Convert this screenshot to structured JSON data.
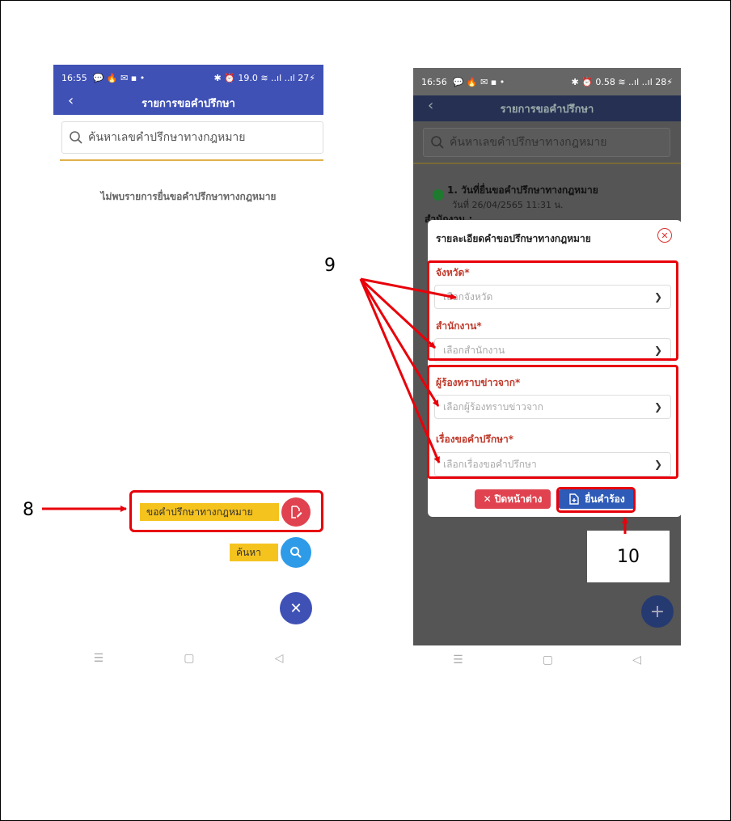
{
  "phone1": {
    "status_time": "16:55",
    "status_icons_left": "💬 🔥 ✉ ▪ •",
    "status_icons_right": "✱ ⏰ 19.0 ≋ ..ıl ..ıl 27⚡",
    "title": "รายการขอคำปรึกษา",
    "search_placeholder": "ค้นหาเลขคำปรึกษาทางกฎหมาย",
    "empty_message": "ไม่พบรายการยื่นขอคำปรึกษาทางกฎหมาย",
    "fab_request_label": "ขอคำปรึกษาทางกฎหมาย",
    "fab_search_label": "ค้นหา",
    "fab_close_symbol": "✕"
  },
  "phone2": {
    "status_time": "16:56",
    "status_icons_left": "💬 🔥 ✉ ▪ •",
    "status_icons_right": "✱ ⏰ 0.58 ≋ ..ıl ..ıl 28⚡",
    "title": "รายการขอคำปรึกษา",
    "search_placeholder": "ค้นหาเลขคำปรึกษาทางกฎหมาย",
    "list_item_title": "1. วันที่ยื่นขอคำปรึกษาทางกฎหมาย",
    "list_item_date": "วันที่ 26/04/2565 11:31 น.",
    "list_item_office": "สำนักงาน :",
    "fab_add_symbol": "+"
  },
  "modal": {
    "title": "รายละเอียดคำขอปรึกษาทางกฎหมาย",
    "fields": [
      {
        "label": "จังหวัด*",
        "placeholder": "เลือกจังหวัด"
      },
      {
        "label": "สำนักงาน*",
        "placeholder": "เลือกสำนักงาน"
      },
      {
        "label": "ผู้ร้องทราบข่าวจาก*",
        "placeholder": "เลือกผู้ร้องทราบข่าวจาก"
      },
      {
        "label": "เรื่องขอคำปรึกษา*",
        "placeholder": "เลือกเรื่องขอคำปรึกษา"
      }
    ],
    "close_button": "ปิดหน้าต่าง",
    "submit_button": "ยื่นคำร้อง"
  },
  "annotations": {
    "n8": "8",
    "n9": "9",
    "n10": "10"
  },
  "navbar": {
    "menu": "☰",
    "home": "▢",
    "back": "◁"
  },
  "icons": {
    "search": "search-icon",
    "chevron": "chevron-down-icon",
    "close": "close-circle-icon",
    "edit": "edit-document-icon",
    "submit": "document-add-icon"
  },
  "colors": {
    "primary": "#3f51b5",
    "accent_yellow": "#f5c31e",
    "danger": "#e0434f",
    "search_fab": "#2e9be8",
    "close_fab": "#3f51b5",
    "submit": "#2e5bb8",
    "annotation_red": "#e8000a"
  }
}
